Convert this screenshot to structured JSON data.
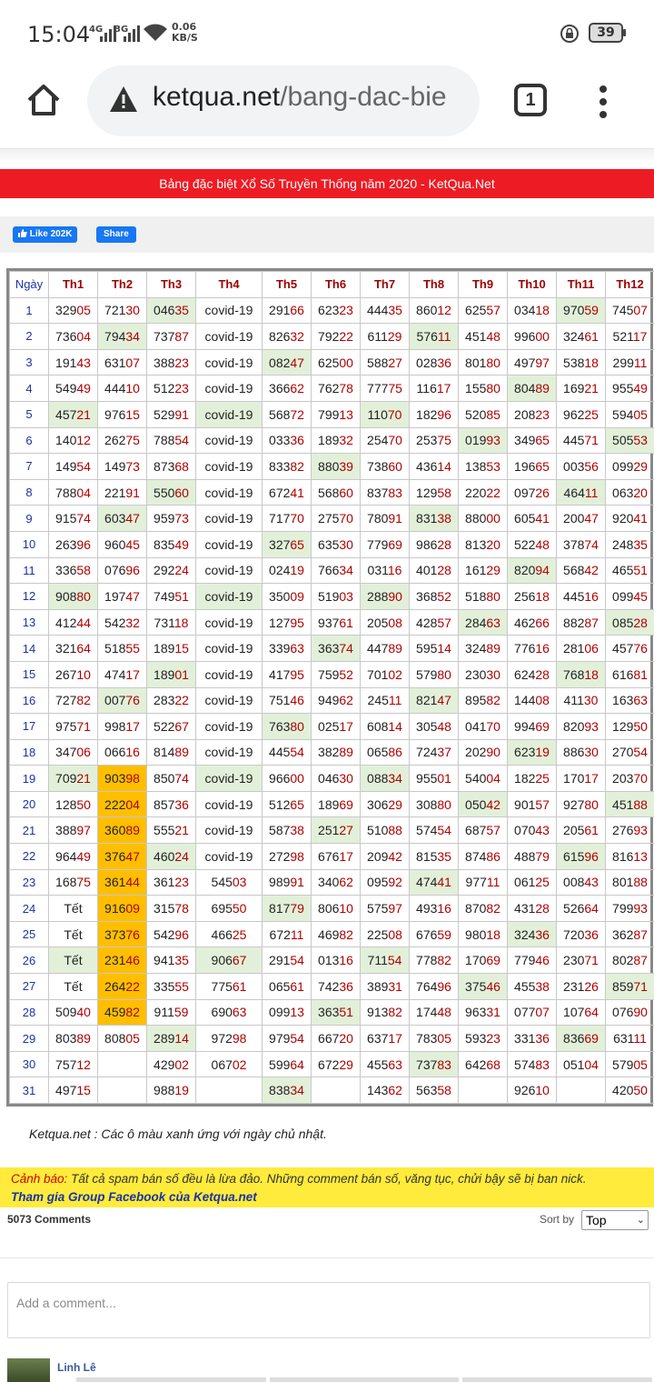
{
  "status": {
    "time": "15:04",
    "net1": "4G",
    "net2": "3G",
    "speed_value": "0.06",
    "speed_unit": "KB/S",
    "battery": "39"
  },
  "browser": {
    "url_main": "ketqua.net",
    "url_path": "/bang-dac-bie",
    "tab_count": "1"
  },
  "page": {
    "title": "Bảng đặc biệt Xổ Số Truyền Thống năm 2020 - KetQua.Net",
    "like_label": "Like 202K",
    "share_label": "Share",
    "note": "Ketqua.net : Các ô màu xanh ứng với ngày chủ nhật.",
    "warning_label": "Cảnh báo:",
    "warning_text": "Tất cả spam bán số đều là lừa đảo. Những comment bán số, văng tục, chửi bậy sẽ bị ban nick.",
    "group_link": "Tham gia Group Facebook của Ketqua.net"
  },
  "table": {
    "headers": [
      "Ngày",
      "Th1",
      "Th2",
      "Th3",
      "Th4",
      "Th5",
      "Th6",
      "Th7",
      "Th8",
      "Th9",
      "Th10",
      "Th11",
      "Th12"
    ],
    "rows": [
      [
        "1",
        "32905",
        "72130",
        "04635",
        "covid-19",
        "29166",
        "62323",
        "44435",
        "86012",
        "62557",
        "03418",
        "97059",
        "74507"
      ],
      [
        "2",
        "73604",
        "79434",
        "73787",
        "covid-19",
        "82632",
        "79222",
        "61129",
        "57611",
        "45148",
        "99600",
        "32461",
        "52117"
      ],
      [
        "3",
        "19143",
        "63107",
        "38823",
        "covid-19",
        "08247",
        "62500",
        "58827",
        "02836",
        "80180",
        "49797",
        "53818",
        "29911"
      ],
      [
        "4",
        "54949",
        "44410",
        "51223",
        "covid-19",
        "36662",
        "76278",
        "77775",
        "11617",
        "15580",
        "80489",
        "16921",
        "95549"
      ],
      [
        "5",
        "45721",
        "97615",
        "52991",
        "covid-19",
        "56872",
        "79913",
        "11070",
        "18296",
        "52085",
        "20823",
        "96225",
        "59405"
      ],
      [
        "6",
        "14012",
        "26275",
        "78854",
        "covid-19",
        "03336",
        "18932",
        "25470",
        "25375",
        "01993",
        "34965",
        "44571",
        "50553"
      ],
      [
        "7",
        "14954",
        "14973",
        "87368",
        "covid-19",
        "83382",
        "88039",
        "73860",
        "43614",
        "13853",
        "19665",
        "00356",
        "09929"
      ],
      [
        "8",
        "78804",
        "22191",
        "55060",
        "covid-19",
        "67241",
        "56860",
        "83783",
        "12958",
        "22022",
        "09726",
        "46411",
        "06320"
      ],
      [
        "9",
        "91574",
        "60347",
        "95973",
        "covid-19",
        "71770",
        "27570",
        "78091",
        "83138",
        "88000",
        "60541",
        "20047",
        "92041"
      ],
      [
        "10",
        "26396",
        "96045",
        "83549",
        "covid-19",
        "32765",
        "63530",
        "77969",
        "98628",
        "81320",
        "52248",
        "37874",
        "24835"
      ],
      [
        "11",
        "33658",
        "07696",
        "29224",
        "covid-19",
        "02419",
        "76634",
        "03116",
        "40128",
        "16129",
        "82094",
        "56842",
        "46551"
      ],
      [
        "12",
        "90880",
        "19747",
        "74951",
        "covid-19",
        "35009",
        "51903",
        "28890",
        "36852",
        "51880",
        "25618",
        "44516",
        "09945"
      ],
      [
        "13",
        "41244",
        "54232",
        "73118",
        "covid-19",
        "12795",
        "93761",
        "20508",
        "42857",
        "28463",
        "46266",
        "88287",
        "08528"
      ],
      [
        "14",
        "32164",
        "51855",
        "18915",
        "covid-19",
        "33963",
        "36374",
        "44789",
        "59514",
        "32489",
        "77616",
        "28106",
        "45776"
      ],
      [
        "15",
        "26710",
        "47417",
        "18901",
        "covid-19",
        "41795",
        "75952",
        "70102",
        "57980",
        "23030",
        "62428",
        "76818",
        "61681"
      ],
      [
        "16",
        "72782",
        "00776",
        "28322",
        "covid-19",
        "75146",
        "94962",
        "24511",
        "82147",
        "89582",
        "14408",
        "41130",
        "16363"
      ],
      [
        "17",
        "97571",
        "99817",
        "52267",
        "covid-19",
        "76380",
        "02517",
        "60814",
        "30548",
        "04170",
        "99469",
        "82093",
        "12950"
      ],
      [
        "18",
        "34706",
        "06616",
        "81489",
        "covid-19",
        "44554",
        "38289",
        "06586",
        "72437",
        "20290",
        "62319",
        "88630",
        "27054"
      ],
      [
        "19",
        "70921",
        "90398",
        "85074",
        "covid-19",
        "96600",
        "04630",
        "08834",
        "95501",
        "54004",
        "18225",
        "17017",
        "20370"
      ],
      [
        "20",
        "12850",
        "22204",
        "85736",
        "covid-19",
        "51265",
        "18969",
        "30629",
        "30880",
        "05042",
        "90157",
        "92780",
        "45188"
      ],
      [
        "21",
        "38897",
        "36089",
        "55521",
        "covid-19",
        "58738",
        "25127",
        "51088",
        "57454",
        "68757",
        "07043",
        "20561",
        "27693"
      ],
      [
        "22",
        "96449",
        "37647",
        "46024",
        "covid-19",
        "27298",
        "67617",
        "20942",
        "81535",
        "87486",
        "48879",
        "61596",
        "81613"
      ],
      [
        "23",
        "16875",
        "36144",
        "36123",
        "54503",
        "98991",
        "34062",
        "09592",
        "47441",
        "97711",
        "06125",
        "00843",
        "80188"
      ],
      [
        "24",
        "Tết",
        "91609",
        "31578",
        "69550",
        "81779",
        "80610",
        "57597",
        "49316",
        "87082",
        "43128",
        "52664",
        "79993"
      ],
      [
        "25",
        "Tết",
        "37376",
        "54296",
        "46625",
        "67211",
        "46982",
        "22508",
        "67659",
        "98018",
        "32436",
        "72036",
        "36287"
      ],
      [
        "26",
        "Tết",
        "23146",
        "94135",
        "90667",
        "29154",
        "01316",
        "71154",
        "77882",
        "17069",
        "77946",
        "23071",
        "80287"
      ],
      [
        "27",
        "Tết",
        "26422",
        "33555",
        "77561",
        "06561",
        "74236",
        "38931",
        "76496",
        "37546",
        "45538",
        "23126",
        "85971"
      ],
      [
        "28",
        "50940",
        "45982",
        "91159",
        "69063",
        "09913",
        "36351",
        "91382",
        "17448",
        "96331",
        "07707",
        "10764",
        "07690"
      ],
      [
        "29",
        "80389",
        "80805",
        "28914",
        "97298",
        "97954",
        "66720",
        "63717",
        "78305",
        "59323",
        "33136",
        "83669",
        "63111"
      ],
      [
        "30",
        "75712",
        "",
        "42902",
        "06702",
        "59964",
        "67229",
        "45563",
        "73783",
        "64268",
        "57483",
        "05104",
        "57905"
      ],
      [
        "31",
        "49715",
        "",
        "98819",
        "",
        "83834",
        "",
        "14362",
        "56358",
        "",
        "92610",
        "",
        "42050"
      ]
    ],
    "green_cells": [
      [
        1,
        3
      ],
      [
        1,
        11
      ],
      [
        2,
        2
      ],
      [
        2,
        8
      ],
      [
        3,
        5
      ],
      [
        4,
        10
      ],
      [
        5,
        1
      ],
      [
        5,
        4
      ],
      [
        5,
        7
      ],
      [
        6,
        9
      ],
      [
        6,
        12
      ],
      [
        7,
        6
      ],
      [
        8,
        3
      ],
      [
        8,
        11
      ],
      [
        9,
        2
      ],
      [
        9,
        8
      ],
      [
        10,
        5
      ],
      [
        11,
        10
      ],
      [
        12,
        1
      ],
      [
        12,
        4
      ],
      [
        12,
        7
      ],
      [
        13,
        9
      ],
      [
        13,
        12
      ],
      [
        14,
        6
      ],
      [
        15,
        3
      ],
      [
        15,
        11
      ],
      [
        16,
        2
      ],
      [
        16,
        8
      ],
      [
        17,
        5
      ],
      [
        18,
        10
      ],
      [
        19,
        1
      ],
      [
        19,
        4
      ],
      [
        19,
        7
      ],
      [
        20,
        9
      ],
      [
        20,
        12
      ],
      [
        21,
        6
      ],
      [
        22,
        3
      ],
      [
        22,
        11
      ],
      [
        23,
        8
      ],
      [
        24,
        5
      ],
      [
        25,
        10
      ],
      [
        26,
        1
      ],
      [
        26,
        4
      ],
      [
        26,
        7
      ],
      [
        27,
        9
      ],
      [
        27,
        12
      ],
      [
        28,
        6
      ],
      [
        29,
        3
      ],
      [
        29,
        11
      ],
      [
        30,
        8
      ],
      [
        31,
        5
      ]
    ],
    "orange_cells": [
      [
        19,
        2
      ],
      [
        20,
        2
      ],
      [
        21,
        2
      ],
      [
        22,
        2
      ],
      [
        23,
        2
      ],
      [
        24,
        2
      ],
      [
        25,
        2
      ],
      [
        26,
        2
      ],
      [
        27,
        2
      ],
      [
        28,
        2
      ]
    ]
  },
  "comments": {
    "count": "5073 Comments",
    "sort_label": "Sort by",
    "sort_value": "Top",
    "placeholder": "Add a comment...",
    "first_author": "Linh Lê"
  }
}
